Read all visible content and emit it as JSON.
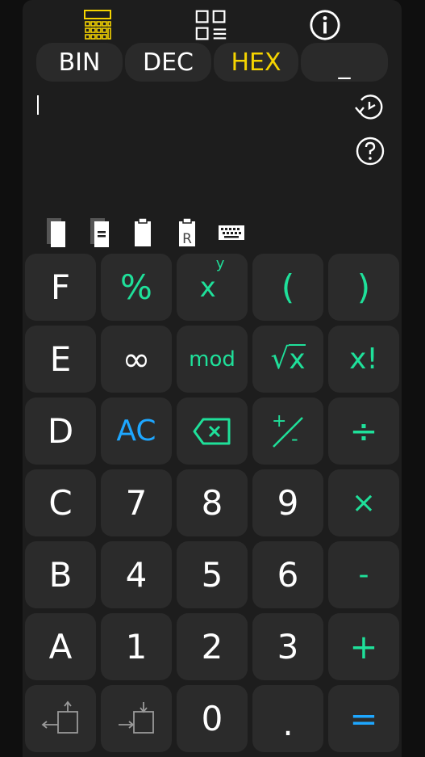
{
  "top_icons": [
    "calculator-icon",
    "grid-menu-icon",
    "info-icon"
  ],
  "modes": [
    {
      "label": "BIN",
      "active": false
    },
    {
      "label": "DEC",
      "active": false
    },
    {
      "label": "HEX",
      "active": true
    },
    {
      "label": "_",
      "active": false
    }
  ],
  "display": {
    "value": ""
  },
  "side_icons": [
    "history-icon",
    "help-icon"
  ],
  "tools": [
    "copy-icon",
    "copy-result-icon",
    "paste-icon",
    "paste-result-icon",
    "keyboard-icon"
  ],
  "keys": {
    "row1": [
      "F",
      "%",
      "x",
      "y",
      "(",
      ")"
    ],
    "row2": [
      "E",
      "∞",
      "mod",
      "√",
      "x",
      "x!"
    ],
    "row3": [
      "D",
      "AC",
      "",
      "+",
      "-",
      "÷"
    ],
    "row4": [
      "C",
      "7",
      "8",
      "9",
      "×"
    ],
    "row5": [
      "B",
      "4",
      "5",
      "6",
      "-"
    ],
    "row6": [
      "A",
      "1",
      "2",
      "3",
      "+"
    ],
    "row7": [
      "",
      "",
      "0",
      ".",
      "="
    ]
  },
  "colors": {
    "accent_yellow": "#f5d400",
    "accent_green": "#1fe09a",
    "accent_blue": "#1ea7ff",
    "key_bg": "#2b2b2b",
    "bg": "#1d1d1d"
  }
}
